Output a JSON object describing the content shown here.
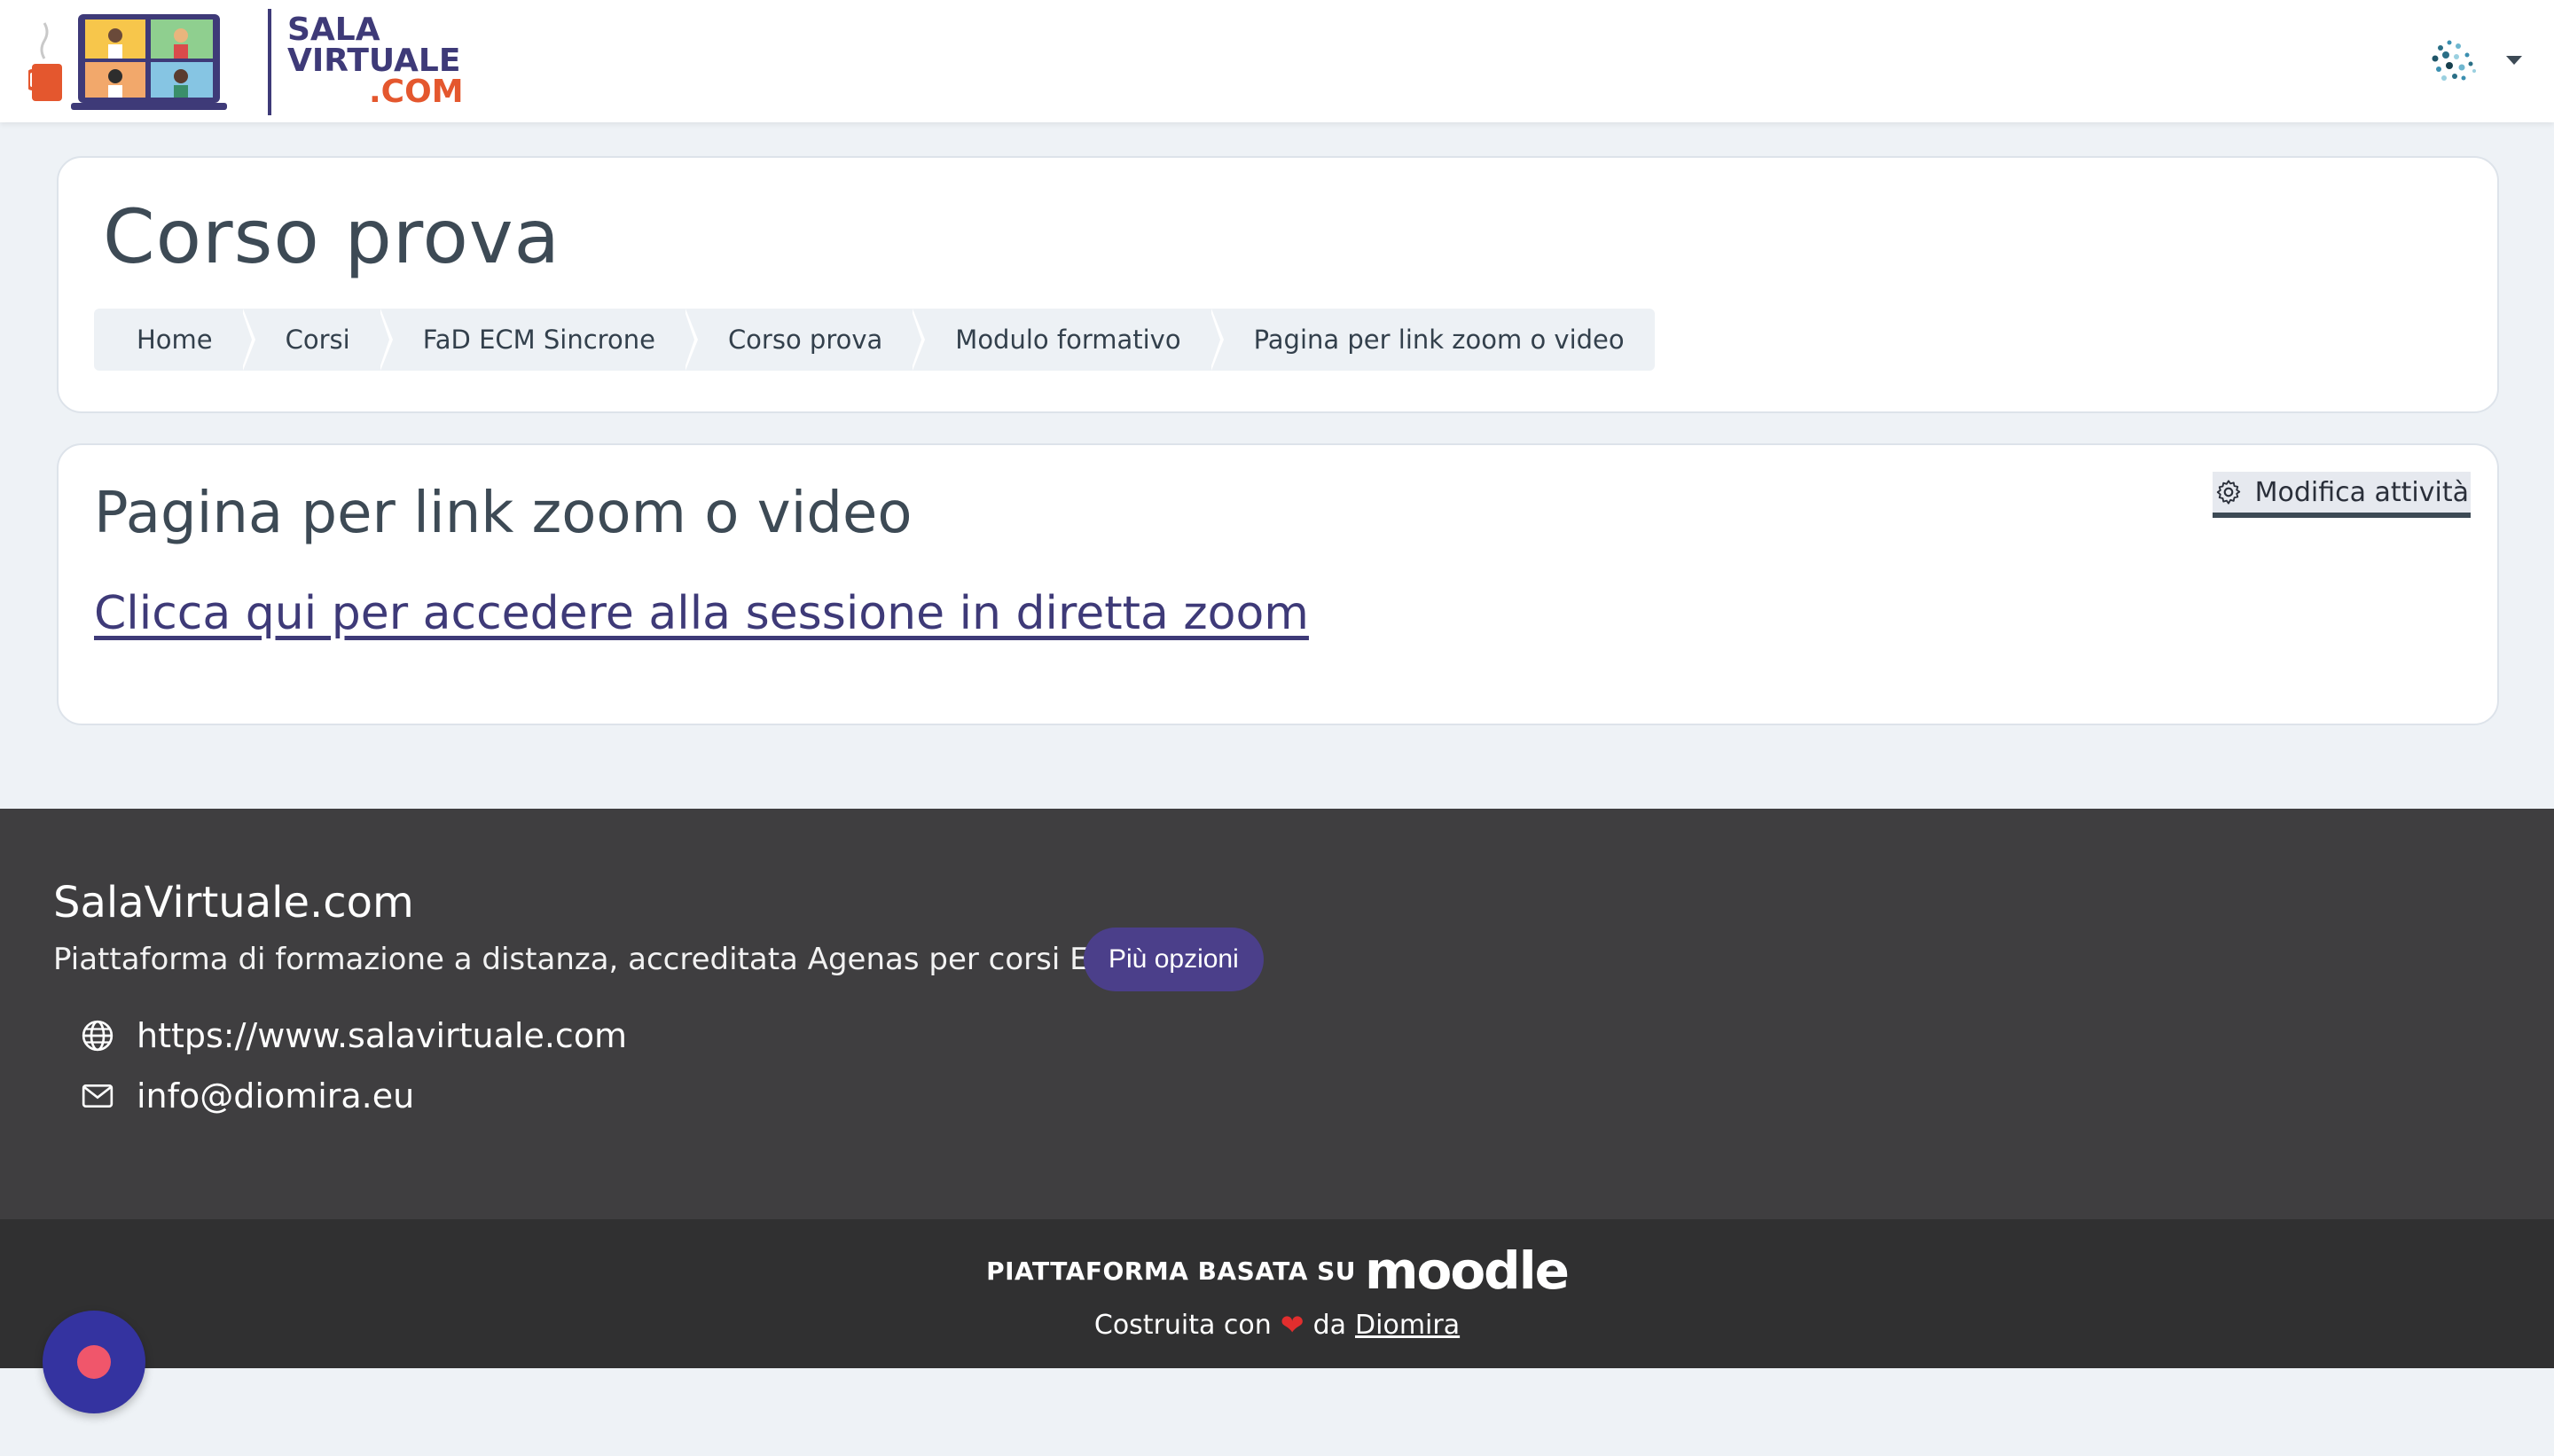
{
  "header": {
    "logo": {
      "line1": "SALA",
      "line2": "VIRTUALE",
      "line3": ".COM"
    },
    "user_avatar_icon": "user-avatar-icon",
    "user_menu_icon": "caret-down-icon"
  },
  "course": {
    "title": "Corso prova",
    "breadcrumb": [
      "Home",
      "Corsi",
      "FaD ECM Sincrone",
      "Corso prova",
      "Modulo formativo",
      "Pagina per link zoom o video"
    ]
  },
  "activity": {
    "title": "Pagina per link zoom o video",
    "edit_label": "Modifica attività",
    "link_text": "Clicca qui per accedere alla sessione in diretta zoom"
  },
  "footer": {
    "site_name": "SalaVirtuale.com",
    "tagline": "Piattaforma di formazione a distanza, accreditata Agenas per corsi ECM",
    "more_button": "Più opzioni",
    "website": "https://www.salavirtuale.com",
    "email": "info@diomira.eu",
    "powered_by": "PIATTAFORMA BASATA SU",
    "moodle_word": "moodle",
    "built_prefix": "Costruita con",
    "built_middle": "da",
    "built_link": "Diomira"
  },
  "colors": {
    "brand_purple": "#3e3a78",
    "brand_orange": "#e4572e",
    "footer_bg": "#3f3e40",
    "footer_bottom_bg": "#303031",
    "button_purple": "#4b3f8a",
    "fab_blue": "#3433a0",
    "fab_dot": "#f0566b"
  }
}
